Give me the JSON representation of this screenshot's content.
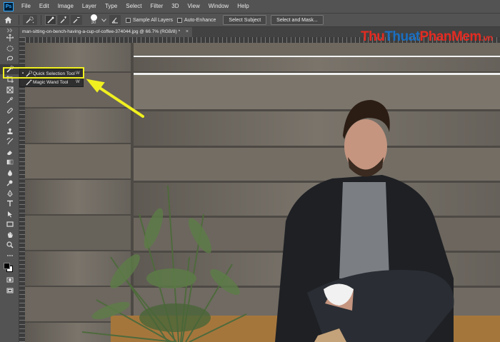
{
  "app": {
    "logo": "Ps",
    "menu": [
      "File",
      "Edit",
      "Image",
      "Layer",
      "Type",
      "Select",
      "Filter",
      "3D",
      "View",
      "Window",
      "Help"
    ]
  },
  "options": {
    "brush_size": "30",
    "sample_all_layers": "Sample All Layers",
    "auto_enhance": "Auto-Enhance",
    "select_subject": "Select Subject",
    "select_and_mask": "Select and Mask..."
  },
  "document": {
    "tab_title": "man-sitting-on-bench-having-a-cup-of-coffee-374044.jpg @ 66.7% (RGB/8) *",
    "tab_close": "×"
  },
  "flyout": {
    "items": [
      {
        "mark": "▪",
        "label": "Quick Selection Tool",
        "shortcut": "W"
      },
      {
        "mark": "",
        "label": "Magic Wand Tool",
        "shortcut": "W"
      }
    ]
  },
  "watermark": {
    "part1": "Thu",
    "part2": "Thuat",
    "part3": "PhanMem",
    "part4": ".vn"
  },
  "colors": {
    "annotation": "#f0f020",
    "ui_bg": "#535353",
    "flyout_bg": "#2f2f2f",
    "wood": "#6b655d"
  }
}
